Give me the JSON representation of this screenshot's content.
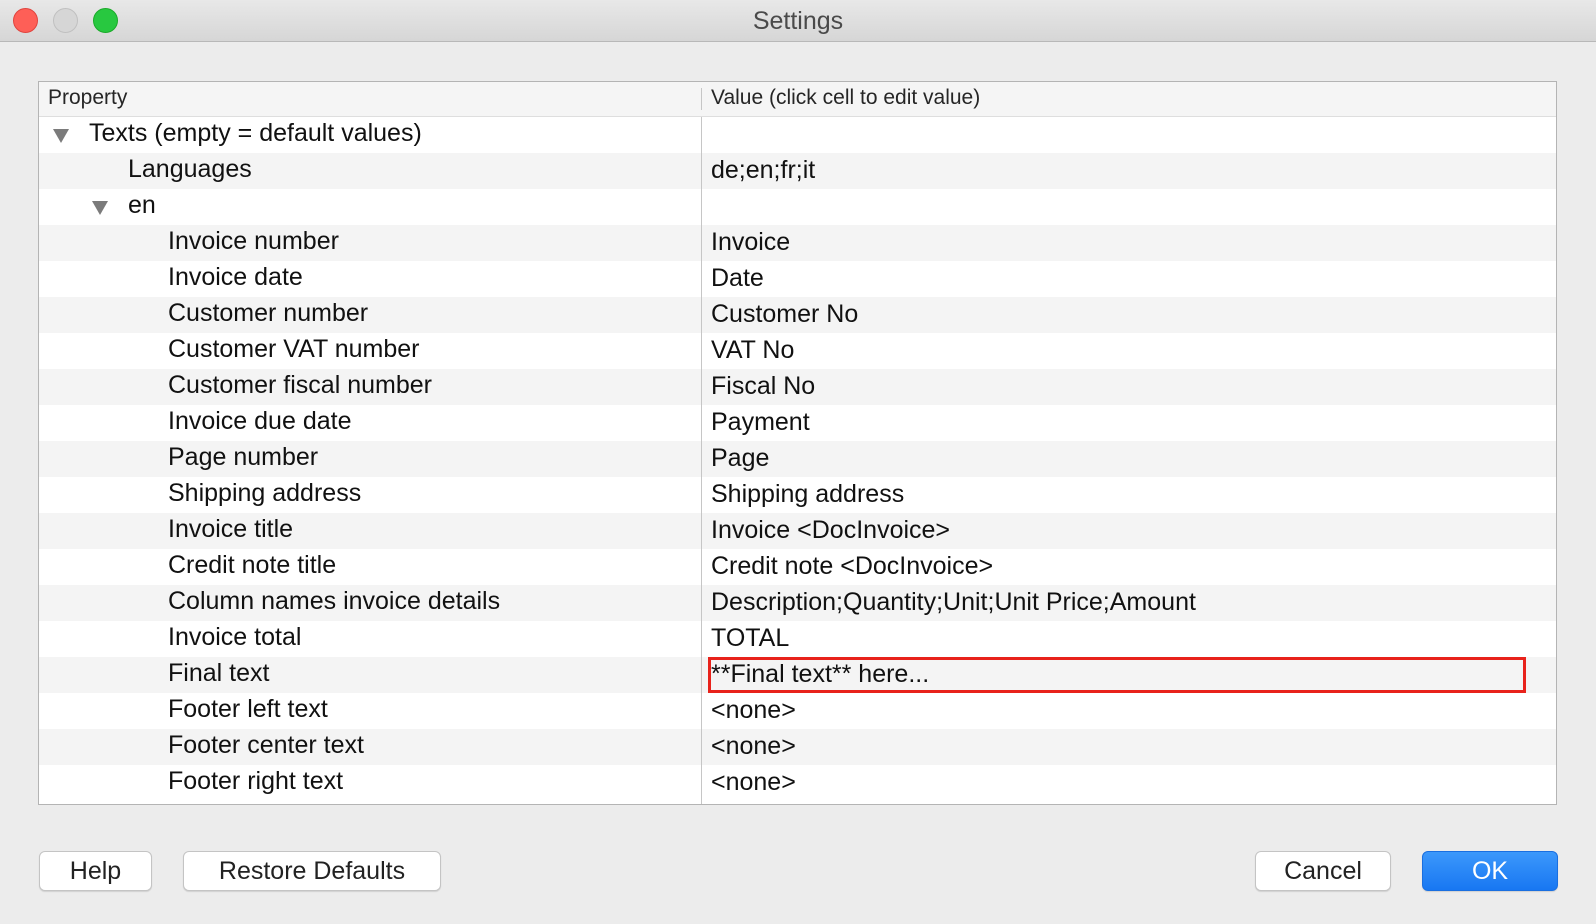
{
  "window": {
    "title": "Settings"
  },
  "table": {
    "columns": [
      "Property",
      "Value (click cell to edit value)"
    ],
    "rows": [
      {
        "label": "Texts (empty = default values)",
        "value": "",
        "level": 0,
        "expandable": true
      },
      {
        "label": "Languages",
        "value": "de;en;fr;it",
        "level": 1,
        "expandable": false
      },
      {
        "label": "en",
        "value": "",
        "level": 1,
        "expandable": true
      },
      {
        "label": "Invoice number",
        "value": "Invoice",
        "level": 2,
        "expandable": false
      },
      {
        "label": "Invoice date",
        "value": "Date",
        "level": 2,
        "expandable": false
      },
      {
        "label": "Customer number",
        "value": "Customer No",
        "level": 2,
        "expandable": false
      },
      {
        "label": "Customer VAT number",
        "value": "VAT No",
        "level": 2,
        "expandable": false
      },
      {
        "label": "Customer fiscal number",
        "value": "Fiscal No",
        "level": 2,
        "expandable": false
      },
      {
        "label": "Invoice due date",
        "value": "Payment",
        "level": 2,
        "expandable": false
      },
      {
        "label": "Page number",
        "value": "Page",
        "level": 2,
        "expandable": false
      },
      {
        "label": "Shipping address",
        "value": "Shipping address",
        "level": 2,
        "expandable": false
      },
      {
        "label": "Invoice title",
        "value": "Invoice <DocInvoice>",
        "level": 2,
        "expandable": false
      },
      {
        "label": "Credit note title",
        "value": "Credit note <DocInvoice>",
        "level": 2,
        "expandable": false
      },
      {
        "label": "Column names invoice details",
        "value": "Description;Quantity;Unit;Unit Price;Amount",
        "level": 2,
        "expandable": false
      },
      {
        "label": "Invoice total",
        "value": "TOTAL",
        "level": 2,
        "expandable": false
      },
      {
        "label": "Final text",
        "value": "**Final text** here...",
        "level": 2,
        "expandable": false,
        "highlighted": true
      },
      {
        "label": "Footer left text",
        "value": "<none>",
        "level": 2,
        "expandable": false
      },
      {
        "label": "Footer center text",
        "value": "<none>",
        "level": 2,
        "expandable": false
      },
      {
        "label": "Footer right text",
        "value": "<none>",
        "level": 2,
        "expandable": false
      }
    ]
  },
  "buttons": {
    "help": "Help",
    "restore": "Restore Defaults",
    "cancel": "Cancel",
    "ok": "OK"
  },
  "colors": {
    "primary_button": "#1877f2",
    "highlight_border": "#e8221b",
    "close": "#fe5f57",
    "maximize": "#28c840"
  },
  "icons": {
    "expand": "disclosure-triangle-down-icon"
  }
}
